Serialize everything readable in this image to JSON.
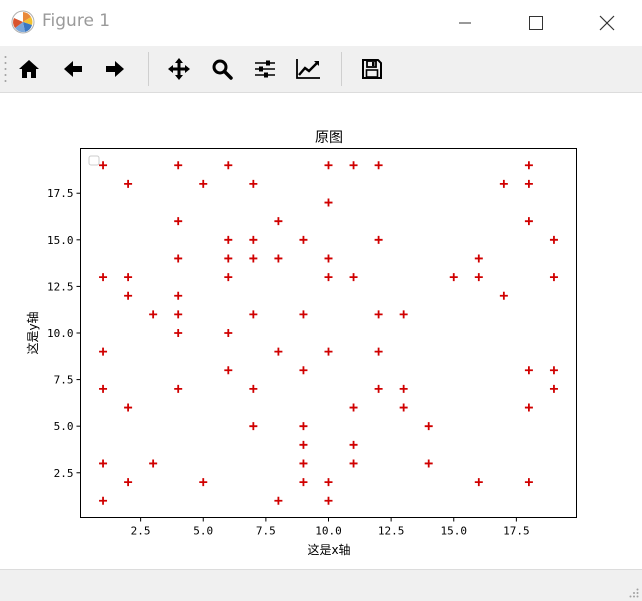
{
  "window": {
    "title": "Figure 1",
    "icon": "matplotlib-logo-icon",
    "controls": [
      "minimize-icon",
      "maximize-icon",
      "close-icon"
    ]
  },
  "toolbar": {
    "items": [
      {
        "icon": "home-icon",
        "name": "home-button"
      },
      {
        "icon": "arrow-left-icon",
        "name": "back-button"
      },
      {
        "icon": "arrow-right-icon",
        "name": "forward-button"
      },
      {
        "icon": "move-arrows-icon",
        "name": "pan-button"
      },
      {
        "icon": "magnifier-icon",
        "name": "zoom-button"
      },
      {
        "icon": "sliders-icon",
        "name": "subplots-button"
      },
      {
        "icon": "line-chart-icon",
        "name": "edit-axes-button"
      },
      {
        "icon": "floppy-disk-icon",
        "name": "save-button"
      }
    ]
  },
  "colors": {
    "marker": "#d00000",
    "axes": "#000000",
    "window_bg": "#f0f0f0"
  },
  "chart_data": {
    "type": "scatter",
    "title": "原图",
    "xlabel": "这是x轴",
    "ylabel": "这是y轴",
    "marker": "+",
    "xlim": [
      0.1,
      19.9
    ],
    "ylim": [
      0.1,
      19.9
    ],
    "xticks": [
      "2.5",
      "5.0",
      "7.5",
      "10.0",
      "12.5",
      "15.0",
      "17.5"
    ],
    "yticks": [
      "2.5",
      "5.0",
      "7.5",
      "10.0",
      "12.5",
      "15.0",
      "17.5"
    ],
    "xtick_values": [
      2.5,
      5.0,
      7.5,
      10.0,
      12.5,
      15.0,
      17.5
    ],
    "ytick_values": [
      2.5,
      5.0,
      7.5,
      10.0,
      12.5,
      15.0,
      17.5
    ],
    "grid": false,
    "legend": {
      "location": "upper-left",
      "entries": []
    },
    "points": [
      [
        1,
        19
      ],
      [
        1,
        13
      ],
      [
        1,
        9
      ],
      [
        1,
        7
      ],
      [
        1,
        3
      ],
      [
        1,
        1
      ],
      [
        2,
        18
      ],
      [
        2,
        13
      ],
      [
        2,
        12
      ],
      [
        2,
        6
      ],
      [
        2,
        2
      ],
      [
        3,
        11
      ],
      [
        3,
        3
      ],
      [
        4,
        19
      ],
      [
        4,
        16
      ],
      [
        4,
        14
      ],
      [
        4,
        12
      ],
      [
        4,
        11
      ],
      [
        4,
        10
      ],
      [
        4,
        7
      ],
      [
        5,
        18
      ],
      [
        5,
        2
      ],
      [
        6,
        19
      ],
      [
        6,
        15
      ],
      [
        6,
        14
      ],
      [
        6,
        13
      ],
      [
        6,
        10
      ],
      [
        6,
        8
      ],
      [
        7,
        18
      ],
      [
        7,
        15
      ],
      [
        7,
        14
      ],
      [
        7,
        11
      ],
      [
        7,
        7
      ],
      [
        7,
        5
      ],
      [
        8,
        16
      ],
      [
        8,
        14
      ],
      [
        8,
        9
      ],
      [
        8,
        1
      ],
      [
        9,
        15
      ],
      [
        9,
        11
      ],
      [
        9,
        8
      ],
      [
        9,
        5
      ],
      [
        9,
        4
      ],
      [
        9,
        3
      ],
      [
        9,
        2
      ],
      [
        10,
        19
      ],
      [
        10,
        17
      ],
      [
        10,
        14
      ],
      [
        10,
        13
      ],
      [
        10,
        9
      ],
      [
        10,
        2
      ],
      [
        10,
        1
      ],
      [
        11,
        19
      ],
      [
        11,
        13
      ],
      [
        11,
        6
      ],
      [
        11,
        4
      ],
      [
        11,
        3
      ],
      [
        12,
        19
      ],
      [
        12,
        15
      ],
      [
        12,
        11
      ],
      [
        12,
        9
      ],
      [
        12,
        7
      ],
      [
        13,
        11
      ],
      [
        13,
        7
      ],
      [
        13,
        6
      ],
      [
        14,
        5
      ],
      [
        14,
        3
      ],
      [
        15,
        13
      ],
      [
        16,
        14
      ],
      [
        16,
        13
      ],
      [
        16,
        2
      ],
      [
        17,
        18
      ],
      [
        17,
        12
      ],
      [
        18,
        19
      ],
      [
        18,
        18
      ],
      [
        18,
        16
      ],
      [
        18,
        8
      ],
      [
        18,
        6
      ],
      [
        18,
        2
      ],
      [
        19,
        15
      ],
      [
        19,
        13
      ],
      [
        19,
        8
      ],
      [
        19,
        7
      ]
    ]
  }
}
